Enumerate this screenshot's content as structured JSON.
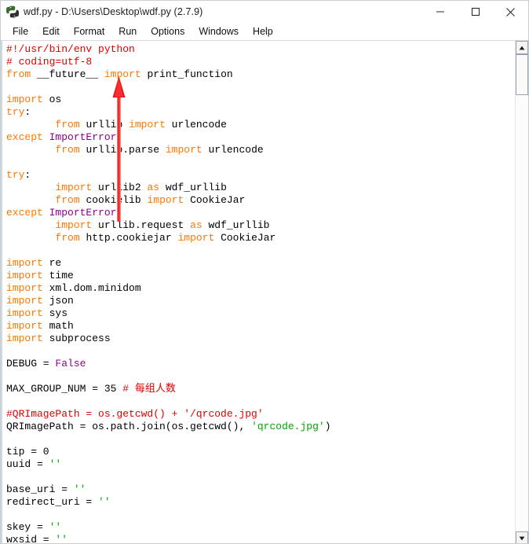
{
  "window": {
    "title": "wdf.py - D:\\Users\\Desktop\\wdf.py (2.7.9)",
    "app_icon": "python-idle-icon",
    "controls": {
      "minimize": "Minimize",
      "maximize": "Maximize",
      "close": "Close"
    }
  },
  "menubar": {
    "items": [
      {
        "label": "File"
      },
      {
        "label": "Edit"
      },
      {
        "label": "Format"
      },
      {
        "label": "Run"
      },
      {
        "label": "Options"
      },
      {
        "label": "Windows"
      },
      {
        "label": "Help"
      }
    ]
  },
  "annotation": {
    "type": "red-arrow",
    "color": "#ee1111",
    "points_to": "Run"
  },
  "scrollbar": {
    "up_arrow": "▲",
    "down_arrow": "▼",
    "thumb_position_percent": 0
  },
  "colors": {
    "keyword": "#ff7700",
    "builtin": "#900090",
    "string": "#00aa00",
    "comment": "#dd0000",
    "text": "#000000",
    "background": "#ffffff",
    "annotation": "#ee1111"
  },
  "editor": {
    "language": "python",
    "lines": [
      [
        {
          "t": "#!/usr/bin/env python",
          "c": "cm"
        }
      ],
      [
        {
          "t": "# coding=utf-8",
          "c": "cm"
        }
      ],
      [
        {
          "t": "from",
          "c": "kw"
        },
        {
          "t": " __future__ ",
          "c": "df"
        },
        {
          "t": "import",
          "c": "kw"
        },
        {
          "t": " print_function",
          "c": "df"
        }
      ],
      [],
      [
        {
          "t": "import",
          "c": "kw"
        },
        {
          "t": " os",
          "c": "df"
        }
      ],
      [
        {
          "t": "try",
          "c": "kw"
        },
        {
          "t": ":",
          "c": "df"
        }
      ],
      [
        {
          "t": "        ",
          "c": "df"
        },
        {
          "t": "from",
          "c": "kw"
        },
        {
          "t": " urllib ",
          "c": "df"
        },
        {
          "t": "import",
          "c": "kw"
        },
        {
          "t": " urlencode",
          "c": "df"
        }
      ],
      [
        {
          "t": "except",
          "c": "kw"
        },
        {
          "t": " ",
          "c": "df"
        },
        {
          "t": "ImportError",
          "c": "bi"
        },
        {
          "t": ":",
          "c": "df"
        }
      ],
      [
        {
          "t": "        ",
          "c": "df"
        },
        {
          "t": "from",
          "c": "kw"
        },
        {
          "t": " urllib.parse ",
          "c": "df"
        },
        {
          "t": "import",
          "c": "kw"
        },
        {
          "t": " urlencode",
          "c": "df"
        }
      ],
      [],
      [
        {
          "t": "try",
          "c": "kw"
        },
        {
          "t": ":",
          "c": "df"
        }
      ],
      [
        {
          "t": "        ",
          "c": "df"
        },
        {
          "t": "import",
          "c": "kw"
        },
        {
          "t": " urllib2 ",
          "c": "df"
        },
        {
          "t": "as",
          "c": "kw"
        },
        {
          "t": " wdf_urllib",
          "c": "df"
        }
      ],
      [
        {
          "t": "        ",
          "c": "df"
        },
        {
          "t": "from",
          "c": "kw"
        },
        {
          "t": " cookielib ",
          "c": "df"
        },
        {
          "t": "import",
          "c": "kw"
        },
        {
          "t": " CookieJar",
          "c": "df"
        }
      ],
      [
        {
          "t": "except",
          "c": "kw"
        },
        {
          "t": " ",
          "c": "df"
        },
        {
          "t": "ImportError",
          "c": "bi"
        },
        {
          "t": ":",
          "c": "df"
        }
      ],
      [
        {
          "t": "        ",
          "c": "df"
        },
        {
          "t": "import",
          "c": "kw"
        },
        {
          "t": " urllib.request ",
          "c": "df"
        },
        {
          "t": "as",
          "c": "kw"
        },
        {
          "t": " wdf_urllib",
          "c": "df"
        }
      ],
      [
        {
          "t": "        ",
          "c": "df"
        },
        {
          "t": "from",
          "c": "kw"
        },
        {
          "t": " http.cookiejar ",
          "c": "df"
        },
        {
          "t": "import",
          "c": "kw"
        },
        {
          "t": " CookieJar",
          "c": "df"
        }
      ],
      [],
      [
        {
          "t": "import",
          "c": "kw"
        },
        {
          "t": " re",
          "c": "df"
        }
      ],
      [
        {
          "t": "import",
          "c": "kw"
        },
        {
          "t": " time",
          "c": "df"
        }
      ],
      [
        {
          "t": "import",
          "c": "kw"
        },
        {
          "t": " xml.dom.minidom",
          "c": "df"
        }
      ],
      [
        {
          "t": "import",
          "c": "kw"
        },
        {
          "t": " json",
          "c": "df"
        }
      ],
      [
        {
          "t": "import",
          "c": "kw"
        },
        {
          "t": " sys",
          "c": "df"
        }
      ],
      [
        {
          "t": "import",
          "c": "kw"
        },
        {
          "t": " math",
          "c": "df"
        }
      ],
      [
        {
          "t": "import",
          "c": "kw"
        },
        {
          "t": " subprocess",
          "c": "df"
        }
      ],
      [],
      [
        {
          "t": "DEBUG = ",
          "c": "df"
        },
        {
          "t": "False",
          "c": "bi"
        }
      ],
      [],
      [
        {
          "t": "MAX_GROUP_NUM = 35 ",
          "c": "df"
        },
        {
          "t": "# 每组人数",
          "c": "cm"
        }
      ],
      [],
      [
        {
          "t": "#QRImagePath = os.getcwd() + '/qrcode.jpg'",
          "c": "cm"
        }
      ],
      [
        {
          "t": "QRImagePath = os.path.join(os.getcwd(), ",
          "c": "df"
        },
        {
          "t": "'qrcode.jpg'",
          "c": "st"
        },
        {
          "t": ")",
          "c": "df"
        }
      ],
      [],
      [
        {
          "t": "tip = 0",
          "c": "df"
        }
      ],
      [
        {
          "t": "uuid = ",
          "c": "df"
        },
        {
          "t": "''",
          "c": "st"
        }
      ],
      [],
      [
        {
          "t": "base_uri = ",
          "c": "df"
        },
        {
          "t": "''",
          "c": "st"
        }
      ],
      [
        {
          "t": "redirect_uri = ",
          "c": "df"
        },
        {
          "t": "''",
          "c": "st"
        }
      ],
      [],
      [
        {
          "t": "skey = ",
          "c": "df"
        },
        {
          "t": "''",
          "c": "st"
        }
      ],
      [
        {
          "t": "wxsid = ",
          "c": "df"
        },
        {
          "t": "''",
          "c": "st"
        }
      ]
    ]
  }
}
